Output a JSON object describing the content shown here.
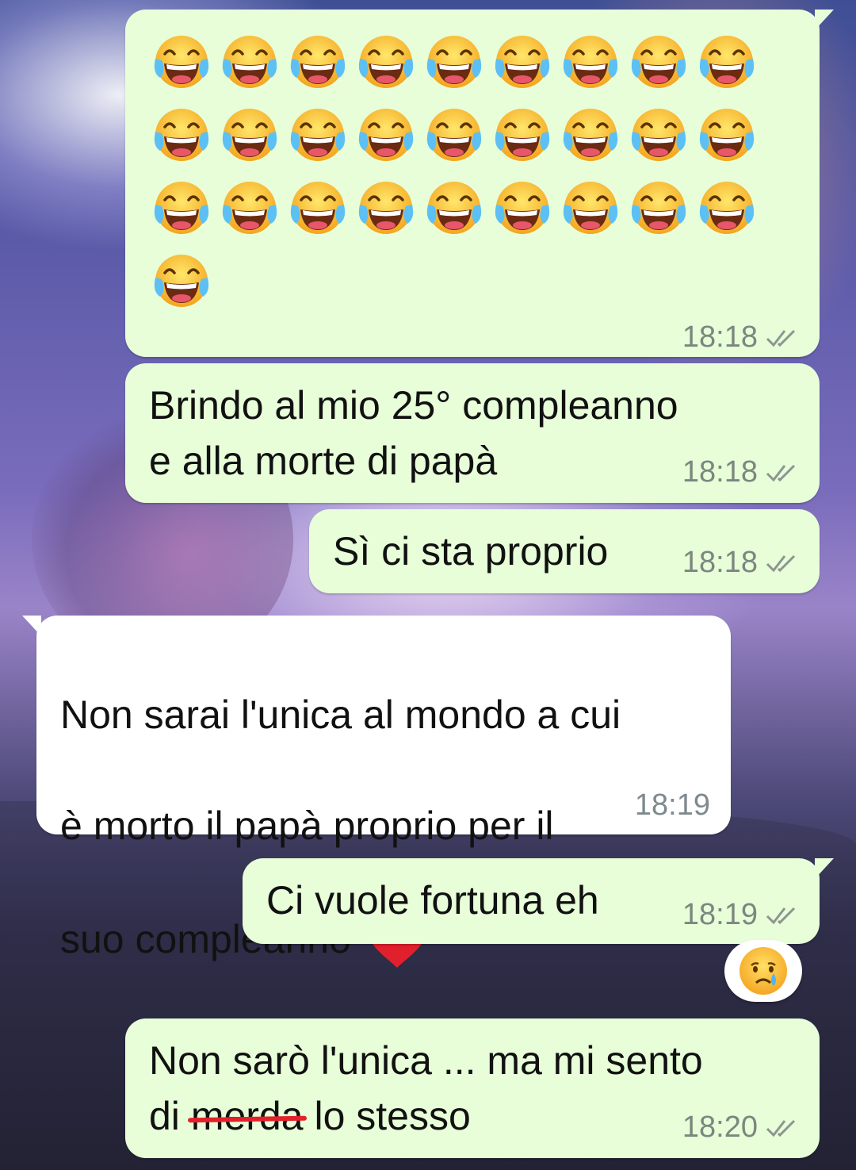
{
  "messages": {
    "m1": {
      "emoji_icon": "face-with-tears-of-joy-icon",
      "emoji_count": 28,
      "time": "18:18"
    },
    "m2": {
      "text": "Brindo al mio 25° compleanno\ne alla morte di papà",
      "time": "18:18"
    },
    "m3": {
      "text": "Sì ci sta proprio",
      "time": "18:18"
    },
    "m4": {
      "line1": "Non sarai l'unica al mondo a cui",
      "line2": "è morto il papà proprio per il",
      "line3": "suo compleanno",
      "emoji_icon": "red-heart-icon",
      "time": "18:19"
    },
    "m5": {
      "text": "Ci vuole fortuna eh",
      "time": "18:19"
    },
    "m6": {
      "line1": "Non sarò l'unica ... ma mi sento",
      "prefix": "di",
      "struck": "merda",
      "suffix": "lo stesso",
      "time": "18:20"
    }
  },
  "reaction": {
    "icon": "crying-face-icon"
  },
  "colors": {
    "outgoing_bubble": "#e7fed9",
    "incoming_bubble": "#ffffff",
    "timestamp": "#7b877f",
    "strike": "#e3212a"
  }
}
